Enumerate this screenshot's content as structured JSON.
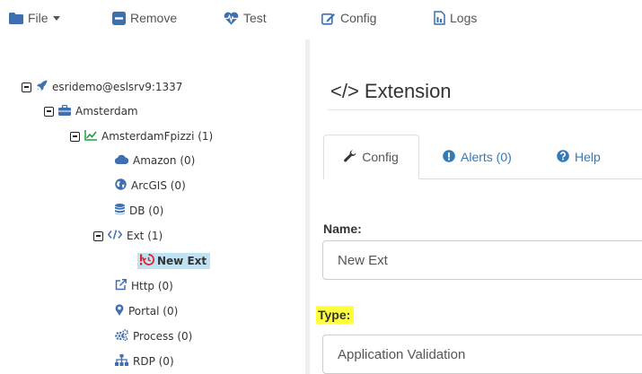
{
  "toolbar": {
    "file_label": "File",
    "remove_label": "Remove",
    "test_label": "Test",
    "config_label": "Config",
    "logs_label": "Logs"
  },
  "tree": {
    "root_label": "esridemo@eslsrv9:1337",
    "amsterdam_label": "Amsterdam",
    "fpizzi_label": "AmsterdamFpizzi (1)",
    "amazon_label": "Amazon (0)",
    "arcgis_label": "ArcGIS (0)",
    "db_label": "DB (0)",
    "ext_label": "Ext (1)",
    "new_ext_label": "New Ext",
    "http_label": "Http (0)",
    "portal_label": "Portal (0)",
    "process_label": "Process (0)",
    "rdp_label": "RDP (0)"
  },
  "detail": {
    "title": "</> Extension",
    "tabs": [
      {
        "label": "Config"
      },
      {
        "label": "Alerts (0)"
      },
      {
        "label": "Help"
      }
    ],
    "name_label": "Name:",
    "name_value": "New Ext",
    "type_label": "Type:",
    "type_value": "Application Validation"
  },
  "colors": {
    "accent": "#337ab7",
    "selected_bg": "#bfe3f5",
    "highlight": "#ffff3b",
    "heart": "#3e6fb0"
  },
  "icons": {
    "file": "folder-icon",
    "remove": "minus-square-icon",
    "test": "heartbeat-icon",
    "config": "edit-icon",
    "logs": "document-icon"
  }
}
